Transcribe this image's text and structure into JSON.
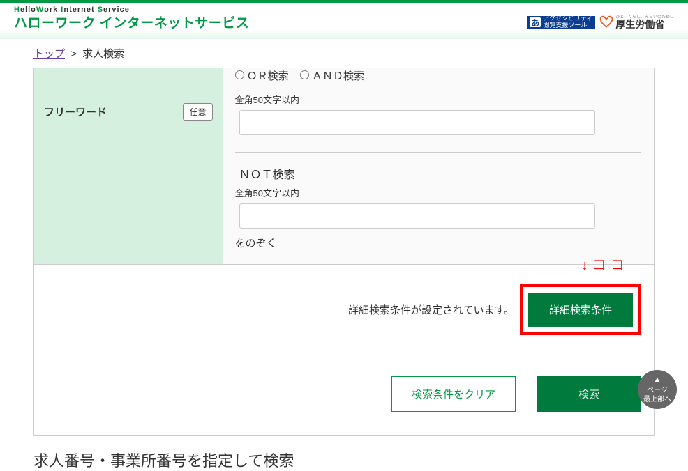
{
  "header": {
    "brand_sub_prefix_h": "H",
    "brand_sub_prefix_rest": "ello",
    "brand_sub_mid_h": "W",
    "brand_sub_mid_rest": "ork ",
    "brand_sub_i": "I",
    "brand_sub_i_rest": "nternet ",
    "brand_sub_s": "S",
    "brand_sub_s_rest": "ervice",
    "brand_main": "ハローワーク インターネットサービス",
    "badge_access_icon": "あ",
    "badge_access_line1": "アクセシビリティ",
    "badge_access_line2": "閲覧支援ツール",
    "mhlw_tag": "ひと、くらし、みらいのために",
    "mhlw_main": "厚生労働省"
  },
  "breadcrumb": {
    "top": "トップ",
    "sep": ">",
    "current": "求人検索"
  },
  "freeword": {
    "label": "フリーワード",
    "optional_badge": "任意",
    "radio_or": "ＯＲ検索",
    "radio_and": "ＡＮＤ検索",
    "hint": "全角50文字以内",
    "not_label": "ＮＯＴ検索",
    "not_hint": "全角50文字以内",
    "suffix": "をのぞく"
  },
  "detail": {
    "annotation": "↓ココ",
    "message": "詳細検索条件が設定されています。",
    "button": "詳細検索条件"
  },
  "actions": {
    "clear": "検索条件をクリア",
    "search": "検索"
  },
  "next_heading": "求人番号・事業所番号を指定して検索",
  "scroll_top": {
    "line1": "ページ",
    "line2": "最上部へ"
  }
}
